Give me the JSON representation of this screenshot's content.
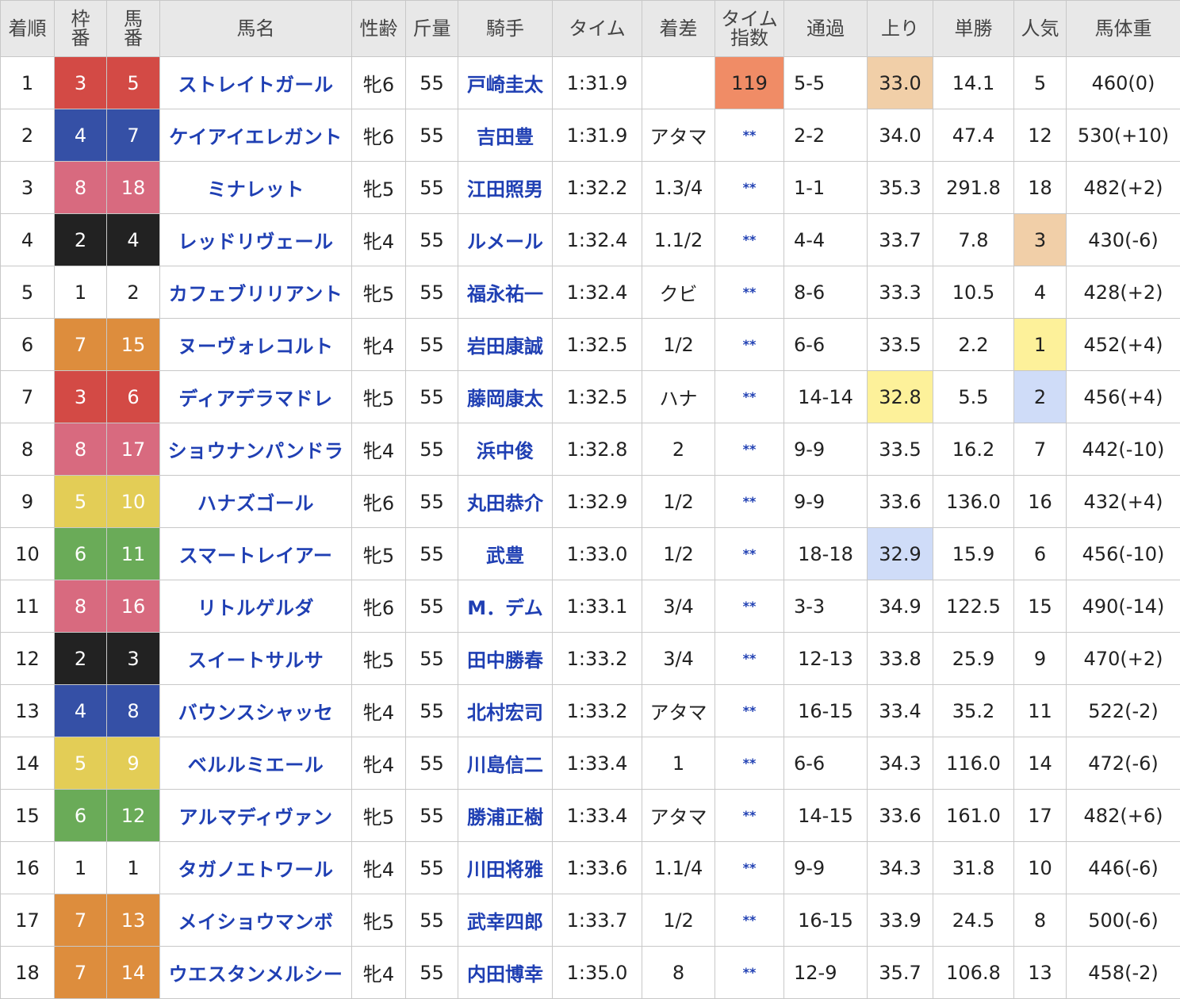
{
  "colors": {
    "waku": {
      "1": {
        "bg": "#ffffff",
        "fg": "#222222"
      },
      "2": {
        "bg": "#222222",
        "fg": "#ffffff"
      },
      "3": {
        "bg": "#d34a45",
        "fg": "#ffffff"
      },
      "4": {
        "bg": "#3550a6",
        "fg": "#ffffff"
      },
      "5": {
        "bg": "#e3cd56",
        "fg": "#ffffff"
      },
      "6": {
        "bg": "#6aab58",
        "fg": "#ffffff"
      },
      "7": {
        "bg": "#dd8d3d",
        "fg": "#ffffff"
      },
      "8": {
        "bg": "#d86a7f",
        "fg": "#ffffff"
      }
    },
    "rank1": "#fdf19a",
    "rank2": "#cfdcf8",
    "rank3": "#f1cfa8",
    "index_top": "#f08c66"
  },
  "headers": [
    {
      "key": "rank",
      "lines": [
        "着順"
      ]
    },
    {
      "key": "waku",
      "lines": [
        "枠",
        "番"
      ]
    },
    {
      "key": "umaban",
      "lines": [
        "馬",
        "番"
      ]
    },
    {
      "key": "horse",
      "lines": [
        "馬名"
      ]
    },
    {
      "key": "sexage",
      "lines": [
        "性齢"
      ]
    },
    {
      "key": "weight",
      "lines": [
        "斤量"
      ]
    },
    {
      "key": "jockey",
      "lines": [
        "騎手"
      ]
    },
    {
      "key": "time",
      "lines": [
        "タイム"
      ]
    },
    {
      "key": "margin",
      "lines": [
        "着差"
      ]
    },
    {
      "key": "index",
      "lines": [
        "タイム",
        "指数"
      ]
    },
    {
      "key": "passing",
      "lines": [
        "通過"
      ]
    },
    {
      "key": "agari",
      "lines": [
        "上り"
      ]
    },
    {
      "key": "odds",
      "lines": [
        "単勝"
      ]
    },
    {
      "key": "pop",
      "lines": [
        "人気"
      ]
    },
    {
      "key": "body",
      "lines": [
        "馬体重"
      ]
    }
  ],
  "rows": [
    {
      "rank": "1",
      "waku": "3",
      "umaban": "5",
      "horse": "ストレイトガール",
      "sexage": "牝6",
      "weight": "55",
      "jockey": "戸崎圭太",
      "time": "1:31.9",
      "margin": "",
      "index": "119",
      "passing": "5-5",
      "agari": "33.0",
      "agari_rank": 3,
      "odds": "14.1",
      "pop": "5",
      "body": "460(0)"
    },
    {
      "rank": "2",
      "waku": "4",
      "umaban": "7",
      "horse": "ケイアイエレガント",
      "sexage": "牝6",
      "weight": "55",
      "jockey": "吉田豊",
      "time": "1:31.9",
      "margin": "アタマ",
      "index": "**",
      "passing": "2-2",
      "agari": "34.0",
      "odds": "47.4",
      "pop": "12",
      "body": "530(+10)"
    },
    {
      "rank": "3",
      "waku": "8",
      "umaban": "18",
      "horse": "ミナレット",
      "sexage": "牝5",
      "weight": "55",
      "jockey": "江田照男",
      "time": "1:32.2",
      "margin": "1.3/4",
      "index": "**",
      "passing": "1-1",
      "agari": "35.3",
      "odds": "291.8",
      "pop": "18",
      "body": "482(+2)"
    },
    {
      "rank": "4",
      "waku": "2",
      "umaban": "4",
      "horse": "レッドリヴェール",
      "sexage": "牝4",
      "weight": "55",
      "jockey": "ルメール",
      "time": "1:32.4",
      "margin": "1.1/2",
      "index": "**",
      "passing": "4-4",
      "agari": "33.7",
      "odds": "7.8",
      "pop": "3",
      "pop_rank": 3,
      "body": "430(-6)"
    },
    {
      "rank": "5",
      "waku": "1",
      "umaban": "2",
      "horse": "カフェブリリアント",
      "sexage": "牝5",
      "weight": "55",
      "jockey": "福永祐一",
      "time": "1:32.4",
      "margin": "クビ",
      "index": "**",
      "passing": "8-6",
      "agari": "33.3",
      "odds": "10.5",
      "pop": "4",
      "body": "428(+2)"
    },
    {
      "rank": "6",
      "waku": "7",
      "umaban": "15",
      "horse": "ヌーヴォレコルト",
      "sexage": "牝4",
      "weight": "55",
      "jockey": "岩田康誠",
      "time": "1:32.5",
      "margin": "1/2",
      "index": "**",
      "passing": "6-6",
      "agari": "33.5",
      "odds": "2.2",
      "pop": "1",
      "pop_rank": 1,
      "body": "452(+4)"
    },
    {
      "rank": "7",
      "waku": "3",
      "umaban": "6",
      "horse": "ディアデラマドレ",
      "sexage": "牝5",
      "weight": "55",
      "jockey": "藤岡康太",
      "time": "1:32.5",
      "margin": "ハナ",
      "index": "**",
      "passing": "14-14",
      "agari": "32.8",
      "agari_rank": 1,
      "odds": "5.5",
      "pop": "2",
      "pop_rank": 2,
      "body": "456(+4)"
    },
    {
      "rank": "8",
      "waku": "8",
      "umaban": "17",
      "horse": "ショウナンパンドラ",
      "sexage": "牝4",
      "weight": "55",
      "jockey": "浜中俊",
      "time": "1:32.8",
      "margin": "2",
      "index": "**",
      "passing": "9-9",
      "agari": "33.5",
      "odds": "16.2",
      "pop": "7",
      "body": "442(-10)"
    },
    {
      "rank": "9",
      "waku": "5",
      "umaban": "10",
      "horse": "ハナズゴール",
      "sexage": "牝6",
      "weight": "55",
      "jockey": "丸田恭介",
      "time": "1:32.9",
      "margin": "1/2",
      "index": "**",
      "passing": "9-9",
      "agari": "33.6",
      "odds": "136.0",
      "pop": "16",
      "body": "432(+4)"
    },
    {
      "rank": "10",
      "waku": "6",
      "umaban": "11",
      "horse": "スマートレイアー",
      "sexage": "牝5",
      "weight": "55",
      "jockey": "武豊",
      "time": "1:33.0",
      "margin": "1/2",
      "index": "**",
      "passing": "18-18",
      "agari": "32.9",
      "agari_rank": 2,
      "odds": "15.9",
      "pop": "6",
      "body": "456(-10)"
    },
    {
      "rank": "11",
      "waku": "8",
      "umaban": "16",
      "horse": "リトルゲルダ",
      "sexage": "牝6",
      "weight": "55",
      "jockey": "M．デム",
      "time": "1:33.1",
      "margin": "3/4",
      "index": "**",
      "passing": "3-3",
      "agari": "34.9",
      "odds": "122.5",
      "pop": "15",
      "body": "490(-14)"
    },
    {
      "rank": "12",
      "waku": "2",
      "umaban": "3",
      "horse": "スイートサルサ",
      "sexage": "牝5",
      "weight": "55",
      "jockey": "田中勝春",
      "time": "1:33.2",
      "margin": "3/4",
      "index": "**",
      "passing": "12-13",
      "agari": "33.8",
      "odds": "25.9",
      "pop": "9",
      "body": "470(+2)"
    },
    {
      "rank": "13",
      "waku": "4",
      "umaban": "8",
      "horse": "バウンスシャッセ",
      "sexage": "牝4",
      "weight": "55",
      "jockey": "北村宏司",
      "time": "1:33.2",
      "margin": "アタマ",
      "index": "**",
      "passing": "16-15",
      "agari": "33.4",
      "odds": "35.2",
      "pop": "11",
      "body": "522(-2)"
    },
    {
      "rank": "14",
      "waku": "5",
      "umaban": "9",
      "horse": "ベルルミエール",
      "sexage": "牝4",
      "weight": "55",
      "jockey": "川島信二",
      "time": "1:33.4",
      "margin": "1",
      "index": "**",
      "passing": "6-6",
      "agari": "34.3",
      "odds": "116.0",
      "pop": "14",
      "body": "472(-6)"
    },
    {
      "rank": "15",
      "waku": "6",
      "umaban": "12",
      "horse": "アルマディヴァン",
      "sexage": "牝5",
      "weight": "55",
      "jockey": "勝浦正樹",
      "time": "1:33.4",
      "margin": "アタマ",
      "index": "**",
      "passing": "14-15",
      "agari": "33.6",
      "odds": "161.0",
      "pop": "17",
      "body": "482(+6)"
    },
    {
      "rank": "16",
      "waku": "1",
      "umaban": "1",
      "horse": "タガノエトワール",
      "sexage": "牝4",
      "weight": "55",
      "jockey": "川田将雅",
      "time": "1:33.6",
      "margin": "1.1/4",
      "index": "**",
      "passing": "9-9",
      "agari": "34.3",
      "odds": "31.8",
      "pop": "10",
      "body": "446(-6)"
    },
    {
      "rank": "17",
      "waku": "7",
      "umaban": "13",
      "horse": "メイショウマンボ",
      "sexage": "牝5",
      "weight": "55",
      "jockey": "武幸四郎",
      "time": "1:33.7",
      "margin": "1/2",
      "index": "**",
      "passing": "16-15",
      "agari": "33.9",
      "odds": "24.5",
      "pop": "8",
      "body": "500(-6)"
    },
    {
      "rank": "18",
      "waku": "7",
      "umaban": "14",
      "horse": "ウエスタンメルシー",
      "sexage": "牝4",
      "weight": "55",
      "jockey": "内田博幸",
      "time": "1:35.0",
      "margin": "8",
      "index": "**",
      "passing": "12-9",
      "agari": "35.7",
      "odds": "106.8",
      "pop": "13",
      "body": "458(-2)"
    }
  ]
}
